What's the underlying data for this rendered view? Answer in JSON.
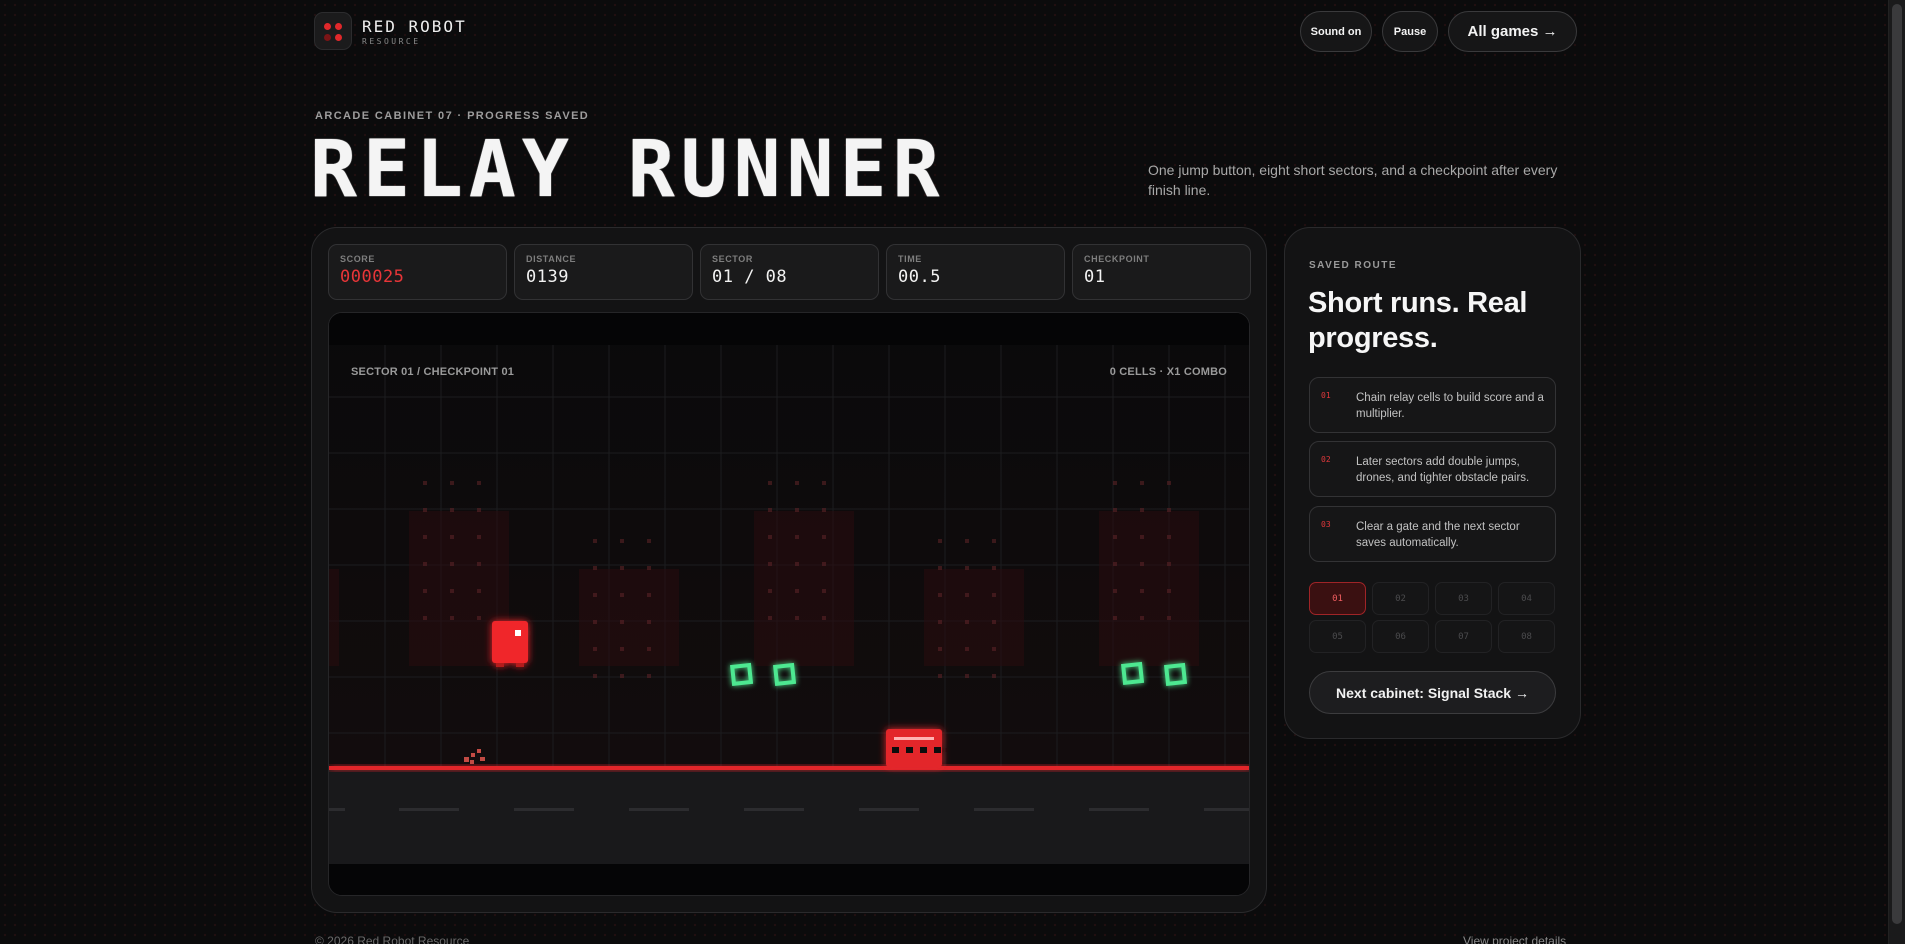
{
  "brand": {
    "name": "RED ROBOT",
    "sub": "RESOURCE"
  },
  "header": {
    "sound_label": "Sound on",
    "pause_label": "Pause",
    "all_games_label": "All games →"
  },
  "hero": {
    "eyebrow": "ARCADE CABINET 07 · PROGRESS SAVED",
    "title": "RELAY RUNNER",
    "tagline": "One jump button, eight short sectors, and a checkpoint after every finish line."
  },
  "stats": [
    {
      "label": "SCORE",
      "value": "000025"
    },
    {
      "label": "DISTANCE",
      "value": "0139"
    },
    {
      "label": "SECTOR",
      "value": "01 / 08"
    },
    {
      "label": "TIME",
      "value": "00.5"
    },
    {
      "label": "CHECKPOINT",
      "value": "01"
    }
  ],
  "hud": {
    "left": "SECTOR 01 / CHECKPOINT 01",
    "right": "0 CELLS · X1 COMBO"
  },
  "side": {
    "eyebrow": "SAVED ROUTE",
    "title": "Short runs. Real progress.",
    "tips": [
      {
        "num": "01",
        "text": "Chain relay cells to build score and a multiplier."
      },
      {
        "num": "02",
        "text": "Later sectors add double jumps, drones, and tighter obstacle pairs."
      },
      {
        "num": "03",
        "text": "Clear a gate and the next sector saves automatically."
      }
    ],
    "sectors": [
      "01",
      "02",
      "03",
      "04",
      "05",
      "06",
      "07",
      "08"
    ],
    "active_sector": "01",
    "next_label": "Next cabinet: Signal Stack →"
  },
  "footer": {
    "left": "© 2026 Red Robot Resource",
    "right": "View project details"
  },
  "colors": {
    "accent": "#e0282b",
    "cell": "#3ddc84",
    "bg": "#0b0b0c"
  }
}
